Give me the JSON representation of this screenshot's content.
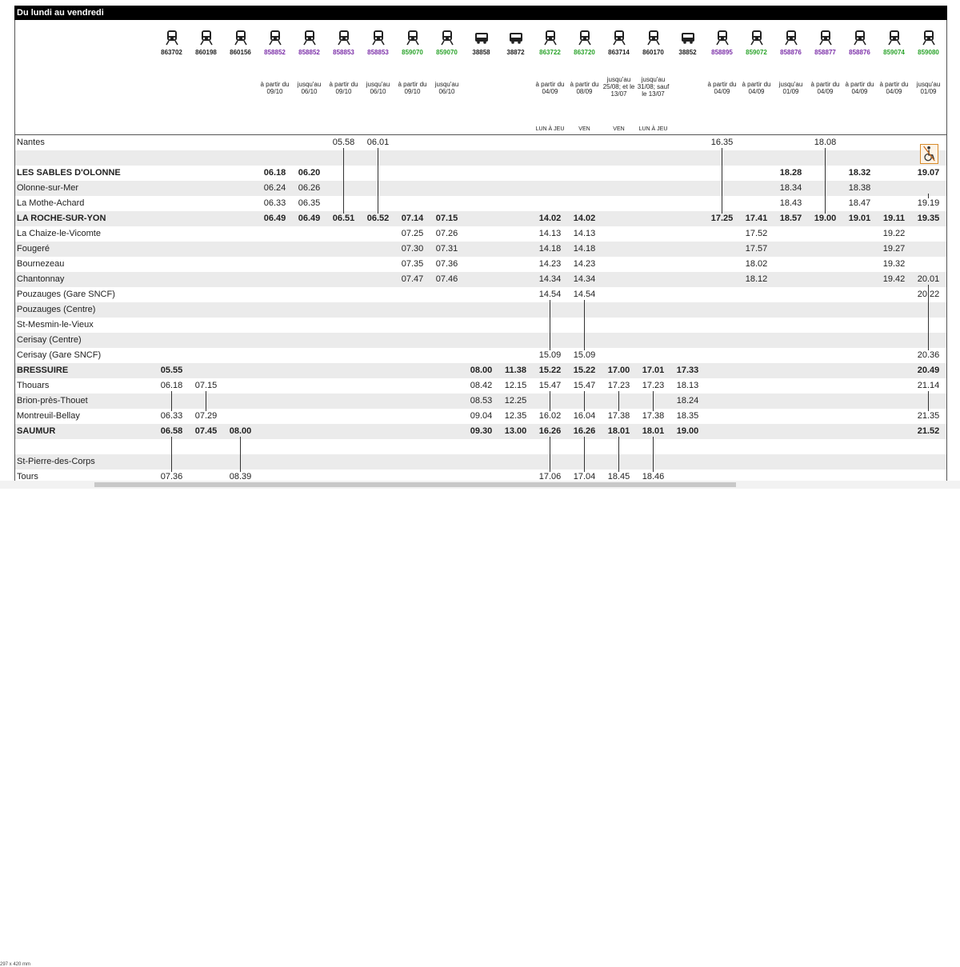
{
  "header_title": "Du lundi au vendredi",
  "trains": [
    {
      "num": "863702",
      "color": "#222222",
      "icon": "train-icon",
      "note": "",
      "days": ""
    },
    {
      "num": "860198",
      "color": "#222222",
      "icon": "train-icon",
      "note": "",
      "days": ""
    },
    {
      "num": "860156",
      "color": "#222222",
      "icon": "train-icon",
      "note": "",
      "days": ""
    },
    {
      "num": "858852",
      "color": "#7b2ea8",
      "icon": "train-icon",
      "note": "à partir du 09/10",
      "days": ""
    },
    {
      "num": "858852",
      "color": "#7b2ea8",
      "icon": "train-icon",
      "note": "jusqu'au 06/10",
      "days": ""
    },
    {
      "num": "858853",
      "color": "#7b2ea8",
      "icon": "train-icon",
      "note": "à partir du 09/10",
      "days": ""
    },
    {
      "num": "858853",
      "color": "#7b2ea8",
      "icon": "train-icon",
      "note": "jusqu'au 06/10",
      "days": ""
    },
    {
      "num": "859070",
      "color": "#2aa32a",
      "icon": "train-icon",
      "note": "à partir du 09/10",
      "days": ""
    },
    {
      "num": "859070",
      "color": "#2aa32a",
      "icon": "train-icon",
      "note": "jusqu'au 06/10",
      "days": ""
    },
    {
      "num": "38858",
      "color": "#222222",
      "icon": "bus-icon",
      "note": "",
      "days": ""
    },
    {
      "num": "38872",
      "color": "#222222",
      "icon": "bus-icon",
      "note": "",
      "days": ""
    },
    {
      "num": "863722",
      "color": "#2aa32a",
      "icon": "train-icon",
      "note": "à partir du 04/09",
      "days": "LUN À JEU"
    },
    {
      "num": "863720",
      "color": "#2aa32a",
      "icon": "train-icon",
      "note": "à partir du 08/09",
      "days": "VEN"
    },
    {
      "num": "863714",
      "color": "#222222",
      "icon": "train-icon",
      "note": "jusqu'au 25/08; et le 13/07",
      "days": "VEN"
    },
    {
      "num": "860170",
      "color": "#222222",
      "icon": "train-icon",
      "note": "jusqu'au 31/08; sauf le 13/07",
      "days": "LUN À JEU"
    },
    {
      "num": "38852",
      "color": "#222222",
      "icon": "bus-icon",
      "note": "",
      "days": ""
    },
    {
      "num": "858895",
      "color": "#7b2ea8",
      "icon": "train-icon",
      "note": "à partir du 04/09",
      "days": ""
    },
    {
      "num": "859072",
      "color": "#2aa32a",
      "icon": "train-icon",
      "note": "à partir du 04/09",
      "days": ""
    },
    {
      "num": "858876",
      "color": "#7b2ea8",
      "icon": "train-icon",
      "note": "jusqu'au 01/09",
      "days": ""
    },
    {
      "num": "858877",
      "color": "#7b2ea8",
      "icon": "train-icon",
      "note": "à partir du 04/09",
      "days": ""
    },
    {
      "num": "858876",
      "color": "#7b2ea8",
      "icon": "train-icon",
      "note": "à partir du 04/09",
      "days": ""
    },
    {
      "num": "859074",
      "color": "#2aa32a",
      "icon": "train-icon",
      "note": "à partir du 04/09",
      "days": ""
    },
    {
      "num": "859080",
      "color": "#2aa32a",
      "icon": "train-icon",
      "note": "jusqu'au 01/09",
      "days": ""
    }
  ],
  "rows": [
    {
      "station": "Nantes",
      "bold": false,
      "times": [
        "",
        "",
        "",
        "",
        "",
        "05.58",
        "06.01",
        "",
        "",
        "",
        "",
        "",
        "",
        "",
        "",
        "",
        "16.35",
        "",
        "",
        "18.08",
        "",
        "",
        ""
      ]
    },
    {
      "station": "",
      "bold": false,
      "times": [
        "",
        "",
        "",
        "",
        "",
        "",
        "",
        "",
        "",
        "",
        "",
        "",
        "",
        "",
        "",
        "",
        "",
        "",
        "",
        "",
        "",
        "",
        ""
      ]
    },
    {
      "station": "LES SABLES D'OLONNE",
      "bold": true,
      "times": [
        "",
        "",
        "",
        "06.18",
        "06.20",
        "",
        "",
        "",
        "",
        "",
        "",
        "",
        "",
        "",
        "",
        "",
        "",
        "",
        "18.28",
        "",
        "18.32",
        "",
        "19.07"
      ]
    },
    {
      "station": "Olonne-sur-Mer",
      "bold": false,
      "times": [
        "",
        "",
        "",
        "06.24",
        "06.26",
        "",
        "",
        "",
        "",
        "",
        "",
        "",
        "",
        "",
        "",
        "",
        "",
        "",
        "18.34",
        "",
        "18.38",
        "",
        ""
      ]
    },
    {
      "station": "La Mothe-Achard",
      "bold": false,
      "times": [
        "",
        "",
        "",
        "06.33",
        "06.35",
        "",
        "",
        "",
        "",
        "",
        "",
        "",
        "",
        "",
        "",
        "",
        "",
        "",
        "18.43",
        "",
        "18.47",
        "",
        "19.19"
      ]
    },
    {
      "station": "LA ROCHE-SUR-YON",
      "bold": true,
      "times": [
        "",
        "",
        "",
        "06.49",
        "06.49",
        "06.51",
        "06.52",
        "07.14",
        "07.15",
        "",
        "",
        "14.02",
        "14.02",
        "",
        "",
        "",
        "17.25",
        "17.41",
        "18.57",
        "19.00",
        "19.01",
        "19.11",
        "19.35"
      ]
    },
    {
      "station": "La Chaize-le-Vicomte",
      "bold": false,
      "times": [
        "",
        "",
        "",
        "",
        "",
        "",
        "",
        "07.25",
        "07.26",
        "",
        "",
        "14.13",
        "14.13",
        "",
        "",
        "",
        "",
        "17.52",
        "",
        "",
        "",
        "19.22",
        ""
      ]
    },
    {
      "station": "Fougeré",
      "bold": false,
      "times": [
        "",
        "",
        "",
        "",
        "",
        "",
        "",
        "07.30",
        "07.31",
        "",
        "",
        "14.18",
        "14.18",
        "",
        "",
        "",
        "",
        "17.57",
        "",
        "",
        "",
        "19.27",
        ""
      ]
    },
    {
      "station": "Bournezeau",
      "bold": false,
      "times": [
        "",
        "",
        "",
        "",
        "",
        "",
        "",
        "07.35",
        "07.36",
        "",
        "",
        "14.23",
        "14.23",
        "",
        "",
        "",
        "",
        "18.02",
        "",
        "",
        "",
        "19.32",
        ""
      ]
    },
    {
      "station": "Chantonnay",
      "bold": false,
      "times": [
        "",
        "",
        "",
        "",
        "",
        "",
        "",
        "07.47",
        "07.46",
        "",
        "",
        "14.34",
        "14.34",
        "",
        "",
        "",
        "",
        "18.12",
        "",
        "",
        "",
        "19.42",
        "20.01"
      ]
    },
    {
      "station": "Pouzauges (Gare SNCF)",
      "bold": false,
      "times": [
        "",
        "",
        "",
        "",
        "",
        "",
        "",
        "",
        "",
        "",
        "",
        "14.54",
        "14.54",
        "",
        "",
        "",
        "",
        "",
        "",
        "",
        "",
        "",
        "20.22"
      ]
    },
    {
      "station": "Pouzauges (Centre)",
      "bold": false,
      "times": [
        "",
        "",
        "",
        "",
        "",
        "",
        "",
        "",
        "",
        "",
        "",
        "",
        "",
        "",
        "",
        "",
        "",
        "",
        "",
        "",
        "",
        "",
        ""
      ]
    },
    {
      "station": "St-Mesmin-le-Vieux",
      "bold": false,
      "times": [
        "",
        "",
        "",
        "",
        "",
        "",
        "",
        "",
        "",
        "",
        "",
        "",
        "",
        "",
        "",
        "",
        "",
        "",
        "",
        "",
        "",
        "",
        ""
      ]
    },
    {
      "station": "Cerisay (Centre)",
      "bold": false,
      "times": [
        "",
        "",
        "",
        "",
        "",
        "",
        "",
        "",
        "",
        "",
        "",
        "",
        "",
        "",
        "",
        "",
        "",
        "",
        "",
        "",
        "",
        "",
        ""
      ]
    },
    {
      "station": "Cerisay (Gare SNCF)",
      "bold": false,
      "times": [
        "",
        "",
        "",
        "",
        "",
        "",
        "",
        "",
        "",
        "",
        "",
        "15.09",
        "15.09",
        "",
        "",
        "",
        "",
        "",
        "",
        "",
        "",
        "",
        "20.36"
      ]
    },
    {
      "station": "BRESSUIRE",
      "bold": true,
      "times": [
        "05.55",
        "",
        "",
        "",
        "",
        "",
        "",
        "",
        "",
        "08.00",
        "11.38",
        "15.22",
        "15.22",
        "17.00",
        "17.01",
        "17.33",
        "",
        "",
        "",
        "",
        "",
        "",
        "20.49"
      ]
    },
    {
      "station": "Thouars",
      "bold": false,
      "times": [
        "06.18",
        "07.15",
        "",
        "",
        "",
        "",
        "",
        "",
        "",
        "08.42",
        "12.15",
        "15.47",
        "15.47",
        "17.23",
        "17.23",
        "18.13",
        "",
        "",
        "",
        "",
        "",
        "",
        "21.14"
      ]
    },
    {
      "station": "Brion-près-Thouet",
      "bold": false,
      "times": [
        "",
        "",
        "",
        "",
        "",
        "",
        "",
        "",
        "",
        "08.53",
        "12.25",
        "",
        "",
        "",
        "",
        "18.24",
        "",
        "",
        "",
        "",
        "",
        "",
        ""
      ]
    },
    {
      "station": "Montreuil-Bellay",
      "bold": false,
      "times": [
        "06.33",
        "07.29",
        "",
        "",
        "",
        "",
        "",
        "",
        "",
        "09.04",
        "12.35",
        "16.02",
        "16.04",
        "17.38",
        "17.38",
        "18.35",
        "",
        "",
        "",
        "",
        "",
        "",
        "21.35"
      ]
    },
    {
      "station": "SAUMUR",
      "bold": true,
      "times": [
        "06.58",
        "07.45",
        "08.00",
        "",
        "",
        "",
        "",
        "",
        "",
        "09.30",
        "13.00",
        "16.26",
        "16.26",
        "18.01",
        "18.01",
        "19.00",
        "",
        "",
        "",
        "",
        "",
        "",
        "21.52"
      ]
    },
    {
      "station": "",
      "bold": false,
      "times": [
        "",
        "",
        "",
        "",
        "",
        "",
        "",
        "",
        "",
        "",
        "",
        "",
        "",
        "",
        "",
        "",
        "",
        "",
        "",
        "",
        "",
        "",
        ""
      ]
    },
    {
      "station": "St-Pierre-des-Corps",
      "bold": false,
      "times": [
        "",
        "",
        "",
        "",
        "",
        "",
        "",
        "",
        "",
        "",
        "",
        "",
        "",
        "",
        "",
        "",
        "",
        "",
        "",
        "",
        "",
        "",
        ""
      ]
    },
    {
      "station": "Tours",
      "bold": false,
      "times": [
        "07.36",
        "",
        "08.39",
        "",
        "",
        "",
        "",
        "",
        "",
        "",
        "",
        "17.06",
        "17.04",
        "18.45",
        "18.46",
        "",
        "",
        "",
        "",
        "",
        "",
        "",
        ""
      ]
    }
  ],
  "passthrough": [
    {
      "col": 5,
      "from": 0,
      "to": 5
    },
    {
      "col": 6,
      "from": 0,
      "to": 5
    },
    {
      "col": 16,
      "from": 0,
      "to": 5
    },
    {
      "col": 19,
      "from": 0,
      "to": 5
    },
    {
      "col": 22,
      "from": 3,
      "to": 4
    },
    {
      "col": 22,
      "from": 9,
      "to": 14
    },
    {
      "col": 11,
      "from": 10,
      "to": 14
    },
    {
      "col": 12,
      "from": 10,
      "to": 14
    },
    {
      "col": 0,
      "from": 16,
      "to": 18
    },
    {
      "col": 1,
      "from": 16,
      "to": 18
    },
    {
      "col": 0,
      "from": 19,
      "to": 22
    },
    {
      "col": 2,
      "from": 19,
      "to": 22
    },
    {
      "col": 11,
      "from": 16,
      "to": 18
    },
    {
      "col": 12,
      "from": 16,
      "to": 18
    },
    {
      "col": 13,
      "from": 16,
      "to": 18
    },
    {
      "col": 14,
      "from": 16,
      "to": 18
    },
    {
      "col": 11,
      "from": 19,
      "to": 22
    },
    {
      "col": 12,
      "from": 19,
      "to": 22
    },
    {
      "col": 13,
      "from": 19,
      "to": 22
    },
    {
      "col": 14,
      "from": 19,
      "to": 22
    },
    {
      "col": 22,
      "from": 16,
      "to": 18
    }
  ],
  "status_text": "297 x 420 mm"
}
